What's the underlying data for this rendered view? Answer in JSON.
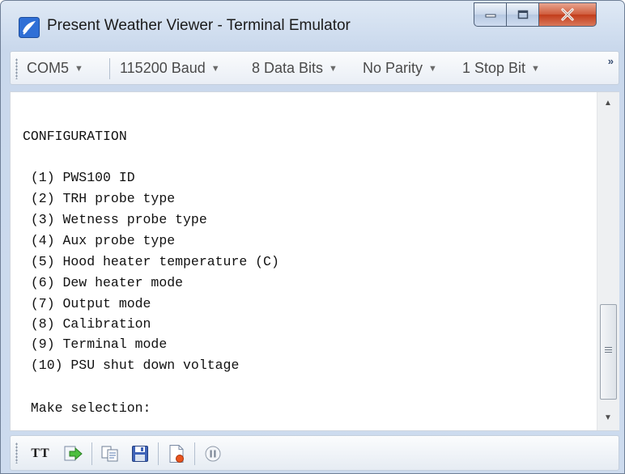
{
  "window": {
    "title": "Present Weather Viewer - Terminal Emulator"
  },
  "settings_toolbar": {
    "port": "COM5",
    "baud": "115200 Baud",
    "data_bits": "8 Data Bits",
    "parity": "No Parity",
    "stop_bits": "1 Stop Bit",
    "overflow": "»"
  },
  "terminal": {
    "lines": [
      "CONFIGURATION",
      " (1) PWS100 ID",
      " (2) TRH probe type",
      " (3) Wetness probe type",
      " (4) Aux probe type",
      " (5) Hood heater temperature (C)",
      " (6) Dew heater mode",
      " (7) Output mode",
      " (8) Calibration",
      " (9) Terminal mode",
      " (10) PSU shut down voltage",
      " Make selection:"
    ]
  },
  "bottom_toolbar": {
    "font_label": "TT",
    "icons": [
      "font-icon",
      "send-file-icon",
      "copy-icon",
      "save-icon",
      "log-file-icon",
      "pause-icon"
    ]
  },
  "colors": {
    "titlebar": "#c9d8ec",
    "close_button": "#c23c1b",
    "terminal_bg": "#ffffff",
    "terminal_text": "#111111"
  }
}
